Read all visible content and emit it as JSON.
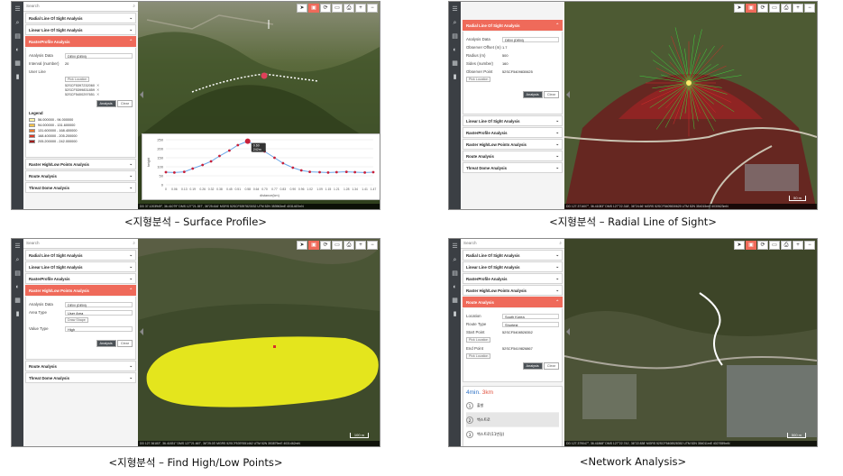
{
  "common": {
    "search_placeholder": "Search",
    "radial": "Radial Line Of Sight Analysis",
    "linear": "Linear Line Of Sight Analysis",
    "raster_profile": "RasterProfile Analysis",
    "raster_hl": "Raster High/Low Points Analysis",
    "route": "Route Analysis",
    "threat": "Threat Dome Analysis",
    "analysis_btn": "Analysis",
    "clear_btn": "Clear",
    "pick_location": "Pick Location"
  },
  "shot1": {
    "caption": "<지형분석 – Surface Profile>",
    "analysis_data_label": "Analysis Data",
    "analysis_data_value": "DEM (DEM)",
    "interval_label": "Interval (number)",
    "interval_value": "20",
    "user_line_label": "User Line",
    "coords": [
      "52SCF5397232060",
      "52SCF5399831859",
      "52SCF5400297651"
    ],
    "legend_title": "Legend",
    "legend": [
      {
        "label": "56.000000 - 94.000000",
        "color": "#fff6a8"
      },
      {
        "label": "94.000000 - 131.600000",
        "color": "#f7c24a"
      },
      {
        "label": "131.600000 - 168.400000",
        "color": "#ec7a2c"
      },
      {
        "label": "168.400000 - 205.200000",
        "color": "#d93a26"
      },
      {
        "label": "205.200000 - 242.000000",
        "color": "#9e1b1b"
      }
    ],
    "chart_ylabel": "height",
    "chart_xlabel": "distance(km)",
    "tooltip_value": "0.60",
    "tooltip_label": "242m",
    "status": "DD 37.1203949°, 36.41079°   DMS 127°21.357', 36°25.616'   MGRS 52SCF5397823032   UTM 52N 353963mE 4031467mN",
    "scale": "100 m"
  },
  "chart_data": {
    "type": "line",
    "xlabel": "distance(km)",
    "ylabel": "height",
    "ylim": [
      0,
      250
    ],
    "yticks": [
      0,
      50,
      100,
      150,
      200,
      250
    ],
    "x": [
      0,
      0.06,
      0.13,
      0.19,
      0.26,
      0.32,
      0.38,
      0.45,
      0.51,
      0.58,
      0.64,
      0.7,
      0.77,
      0.83,
      0.9,
      0.96,
      1.02,
      1.09,
      1.15,
      1.21,
      1.28,
      1.34,
      1.41,
      1.47
    ],
    "xtick_labels": [
      "0",
      "0.06",
      "0.13",
      "0.19",
      "0.26",
      "0.32",
      "0.38",
      "0.45",
      "0.51",
      "0.58",
      "0.64",
      "0.70",
      "0.77",
      "0.83",
      "0.90",
      "0.96",
      "1.02",
      "1.09",
      "1.15",
      "1.21",
      "1.28",
      "1.34",
      "1.41",
      "1.47"
    ],
    "series": [
      {
        "values": [
          70,
          68,
          72,
          90,
          110,
          130,
          160,
          190,
          220,
          242,
          215,
          185,
          150,
          120,
          95,
          80,
          72,
          70,
          68,
          70,
          72,
          70,
          68,
          70
        ]
      }
    ]
  },
  "shot2": {
    "caption": "<지형분석 – Radial Line of Sight>",
    "fields": [
      {
        "k": "Analysis Data",
        "v": "DEM (DEM)"
      },
      {
        "k": "Observer Offset (m)",
        "v": "1.7"
      },
      {
        "k": "Radius (m)",
        "v": "500"
      },
      {
        "k": "Sides (number)",
        "v": "160"
      },
      {
        "k": "Observer Point",
        "v": "52SCF5409830625"
      }
    ],
    "status": "DD 127.371607°, 36.41083°   DMS 127°22.318', 36°24.66'   MGRS 52SCF5409830625   UTM 52N 354015mE 4030623mN",
    "scale": "50 m"
  },
  "shot3": {
    "caption": "<지형분석 – Find High/Low Points>",
    "fields": [
      {
        "k": "Analysis Data",
        "v": "DEM (DEM)"
      },
      {
        "k": "Area Type",
        "v": "User Area"
      },
      {
        "k": "Value Type",
        "v": "High"
      }
    ],
    "draw_shape": "Draw Shape",
    "status": "DD 127.36183°, 36.41831°   DMS 127°21.667', 36°25.03'   MGRS 52SCF5397651462   UTM 52N 353879mE 4031462mN",
    "scale": "100 m"
  },
  "shot4": {
    "caption": "<Network Analysis>",
    "fields": [
      {
        "k": "Location",
        "v": "South Korea"
      },
      {
        "k": "Route Type",
        "v": "Shortest"
      }
    ],
    "start_label": "Start Point",
    "start_value": "52SCF5408528352",
    "end_label": "End Point",
    "end_value": "52SCF5419826867",
    "summary_time": "4min.",
    "summary_dist": "3km",
    "steps": [
      "출발",
      "백스트로",
      "백스트로(11번길)"
    ],
    "status": "DD 127.379047°, 36.41868°   DMS 127°22.741', 36°22.838'   MGRS 52SCF5408528352   UTM 52N 354011mE 4027659mN",
    "scale": "500 m"
  }
}
